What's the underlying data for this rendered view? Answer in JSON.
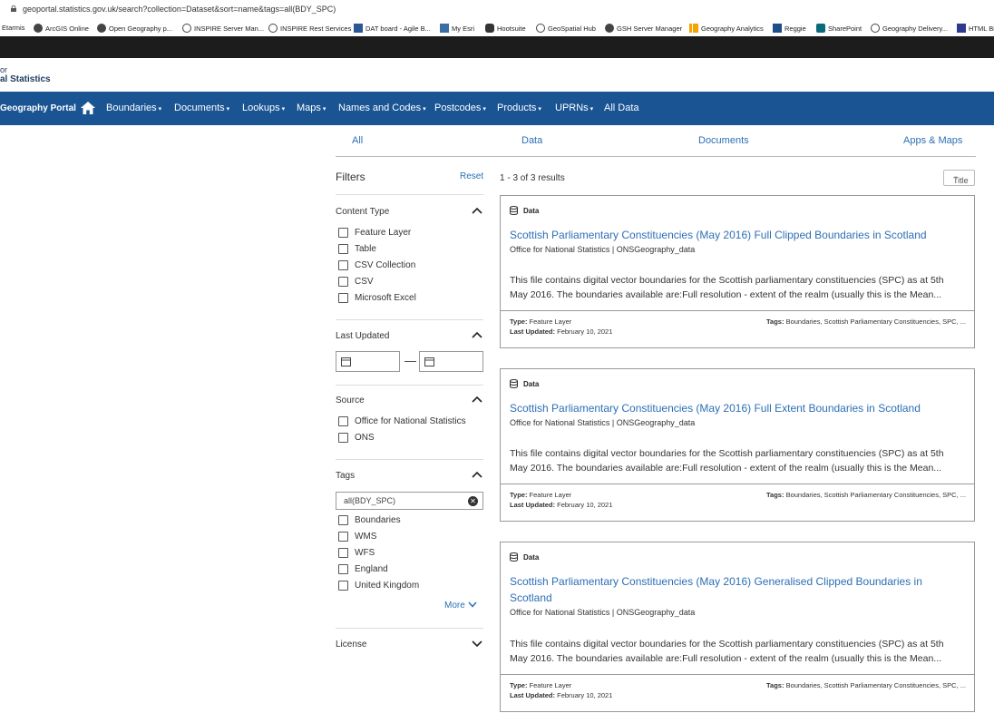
{
  "browser": {
    "url": "geoportal.statistics.gov.uk/search?collection=Dataset&sort=name&tags=all(BDY_SPC)",
    "bookmarks": [
      "Etarmis",
      "ArcGIS Online",
      "Open Geography p...",
      "INSPIRE Server Man...",
      "INSPIRE Rest Services",
      "DAT board - Agile B...",
      "My Esri",
      "Hootsuite",
      "GeoSpatial Hub",
      "GSH Server Manager",
      "Geography Analytics",
      "Reggie",
      "SharePoint",
      "Geography Delivery...",
      "HTML Bi"
    ]
  },
  "logo": {
    "line1": "or",
    "line2": "al Statistics"
  },
  "nav": {
    "brand": "Geography Portal",
    "items": [
      "Boundaries",
      "Documents",
      "Lookups",
      "Maps",
      "Names and Codes",
      "Postcodes",
      "Products",
      "UPRNs",
      "All Data"
    ],
    "caret": "▾"
  },
  "tabs": [
    "All",
    "Data",
    "Documents",
    "Apps & Maps"
  ],
  "filters": {
    "title": "Filters",
    "reset": "Reset",
    "content_type": {
      "label": "Content Type",
      "options": [
        "Feature Layer",
        "Table",
        "CSV Collection",
        "CSV",
        "Microsoft Excel"
      ]
    },
    "last_updated": {
      "label": "Last Updated"
    },
    "source": {
      "label": "Source",
      "options": [
        "Office for National Statistics",
        "ONS"
      ]
    },
    "tags": {
      "label": "Tags",
      "search_value": "all(BDY_SPC)",
      "options": [
        "Boundaries",
        "WMS",
        "WFS",
        "England",
        "United Kingdom"
      ],
      "more": "More"
    },
    "license": {
      "label": "License"
    }
  },
  "results": {
    "count": "1 - 3 of 3 results",
    "sort": "Title",
    "cards": [
      {
        "type": "Data",
        "title": "Scottish Parliamentary Constituencies (May 2016) Full Clipped Boundaries in Scotland",
        "owner": "Office for National Statistics | ONSGeography_data",
        "description": "This file contains digital vector boundaries for the Scottish parliamentary constituencies (SPC) as at 5th May 2016. The boundaries available are:Full resolution - extent of the realm (usually this is the Mean...",
        "type_label": "Type:",
        "type_value": "Feature Layer",
        "updated_label": "Last Updated:",
        "updated_value": "February 10, 2021",
        "tags_label": "Tags:",
        "tags_value": "Boundaries, Scottish Parliamentary Constituencies, SPC, ..."
      },
      {
        "type": "Data",
        "title": "Scottish Parliamentary Constituencies (May 2016) Full Extent Boundaries in Scotland",
        "owner": "Office for National Statistics | ONSGeography_data",
        "description": "This file contains digital vector boundaries for the Scottish parliamentary constituencies (SPC) as at 5th May 2016. The boundaries available are:Full resolution - extent of the realm (usually this is the Mean...",
        "type_label": "Type:",
        "type_value": "Feature Layer",
        "updated_label": "Last Updated:",
        "updated_value": "February 10, 2021",
        "tags_label": "Tags:",
        "tags_value": "Boundaries, Scottish Parliamentary Constituencies, SPC, ..."
      },
      {
        "type": "Data",
        "title": "Scottish Parliamentary Constituencies (May 2016) Generalised Clipped Boundaries in Scotland",
        "owner": "Office for National Statistics | ONSGeography_data",
        "description": "This file contains digital vector boundaries for the Scottish parliamentary constituencies (SPC) as at 5th May 2016. The boundaries available are:Full resolution - extent of the realm (usually this is the Mean...",
        "type_label": "Type:",
        "type_value": "Feature Layer",
        "updated_label": "Last Updated:",
        "updated_value": "February 10, 2021",
        "tags_label": "Tags:",
        "tags_value": "Boundaries, Scottish Parliamentary Constituencies, SPC, ..."
      }
    ]
  },
  "colors": {
    "nav_bg": "#1a5493",
    "link": "#2c6fb5"
  }
}
